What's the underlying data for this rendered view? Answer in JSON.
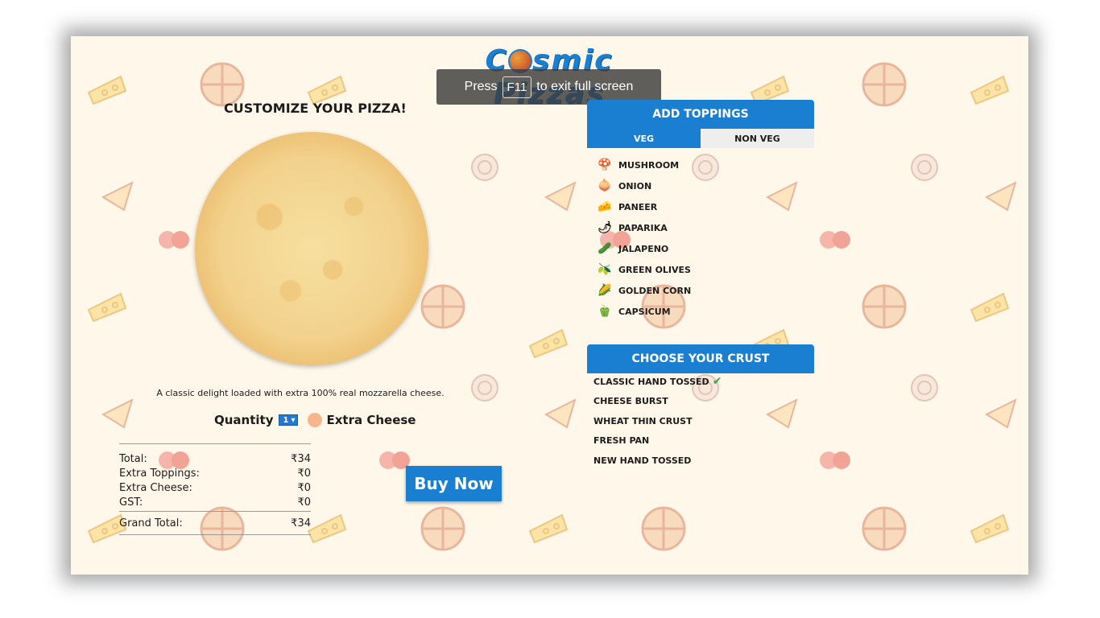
{
  "app": {
    "logo_left": "C",
    "logo_right": "smic Pizzas"
  },
  "fullscreen_banner": {
    "press": "Press",
    "key": "F11",
    "rest": "to exit full screen"
  },
  "customize": {
    "title": "CUSTOMIZE YOUR PIZZA!",
    "description": "A classic delight loaded with extra 100% real mozzarella cheese.",
    "quantity_label": "Quantity",
    "quantity_value": "1",
    "extra_cheese_label": "Extra Cheese"
  },
  "totals": {
    "total_label": "Total:",
    "total_value": "₹34",
    "toppings_label": "Extra Toppings:",
    "toppings_value": "₹0",
    "cheese_label": "Extra Cheese:",
    "cheese_value": "₹0",
    "gst_label": "GST:",
    "gst_value": "₹0",
    "grand_label": "Grand Total:",
    "grand_value": "₹34"
  },
  "buy_button": "Buy Now",
  "toppings": {
    "title": "ADD TOPPINGS",
    "tabs": [
      "VEG",
      "NON VEG"
    ],
    "items": [
      {
        "label": "MUSHROOM",
        "icon": "mushroom-icon"
      },
      {
        "label": "ONION",
        "icon": "onion-icon"
      },
      {
        "label": "PANEER",
        "icon": "paneer-icon"
      },
      {
        "label": "PAPARIKA",
        "icon": "paprika-icon"
      },
      {
        "label": "JALAPENO",
        "icon": "jalapeno-icon"
      },
      {
        "label": "GREEN OLIVES",
        "icon": "olives-icon"
      },
      {
        "label": "GOLDEN CORN",
        "icon": "corn-icon"
      },
      {
        "label": "CAPSICUM",
        "icon": "capsicum-icon"
      }
    ]
  },
  "crust": {
    "title": "CHOOSE YOUR CRUST",
    "items": [
      {
        "label": "CLASSIC HAND TOSSED",
        "selected": true
      },
      {
        "label": "CHEESE BURST",
        "selected": false
      },
      {
        "label": "WHEAT THIN CRUST",
        "selected": false
      },
      {
        "label": "FRESH PAN",
        "selected": false
      },
      {
        "label": "NEW HAND TOSSED",
        "selected": false
      }
    ]
  },
  "colors": {
    "accent": "#1a7fd0",
    "background": "#fff8ea",
    "check": "#3aa84b"
  }
}
